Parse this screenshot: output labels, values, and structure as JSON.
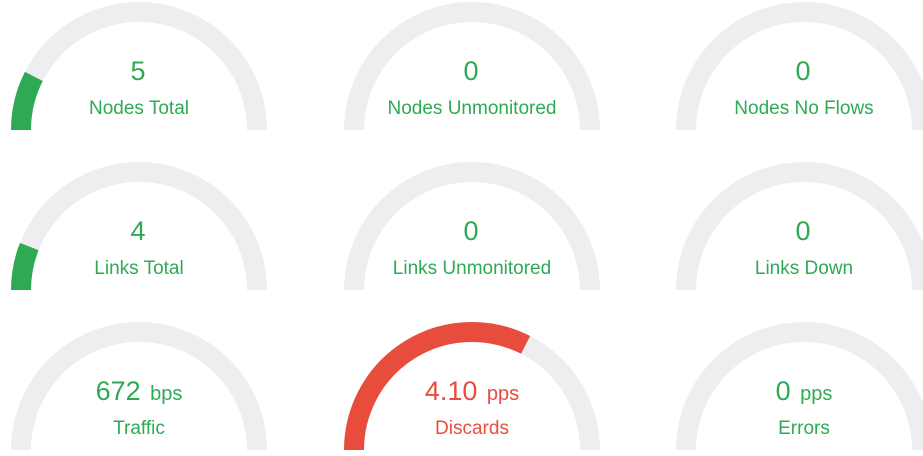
{
  "colors": {
    "ok": "#2eaa55",
    "alert": "#e84c3d",
    "track": "#eceeef"
  },
  "gauges": [
    {
      "value": "5",
      "unit": "",
      "label": "Nodes Total",
      "status": "ok",
      "fill": 0.15
    },
    {
      "value": "0",
      "unit": "",
      "label": "Nodes Unmonitored",
      "status": "ok",
      "fill": 0
    },
    {
      "value": "0",
      "unit": "",
      "label": "Nodes No Flows",
      "status": "ok",
      "fill": 0
    },
    {
      "value": "4",
      "unit": "",
      "label": "Links Total",
      "status": "ok",
      "fill": 0.12
    },
    {
      "value": "0",
      "unit": "",
      "label": "Links Unmonitored",
      "status": "ok",
      "fill": 0
    },
    {
      "value": "0",
      "unit": "",
      "label": "Links Down",
      "status": "ok",
      "fill": 0
    },
    {
      "value": "672",
      "unit": "bps",
      "label": "Traffic",
      "status": "ok",
      "fill": 0
    },
    {
      "value": "4.10",
      "unit": "pps",
      "label": "Discards",
      "status": "alert",
      "fill": 0.65
    },
    {
      "value": "0",
      "unit": "pps",
      "label": "Errors",
      "status": "ok",
      "fill": 0
    }
  ]
}
